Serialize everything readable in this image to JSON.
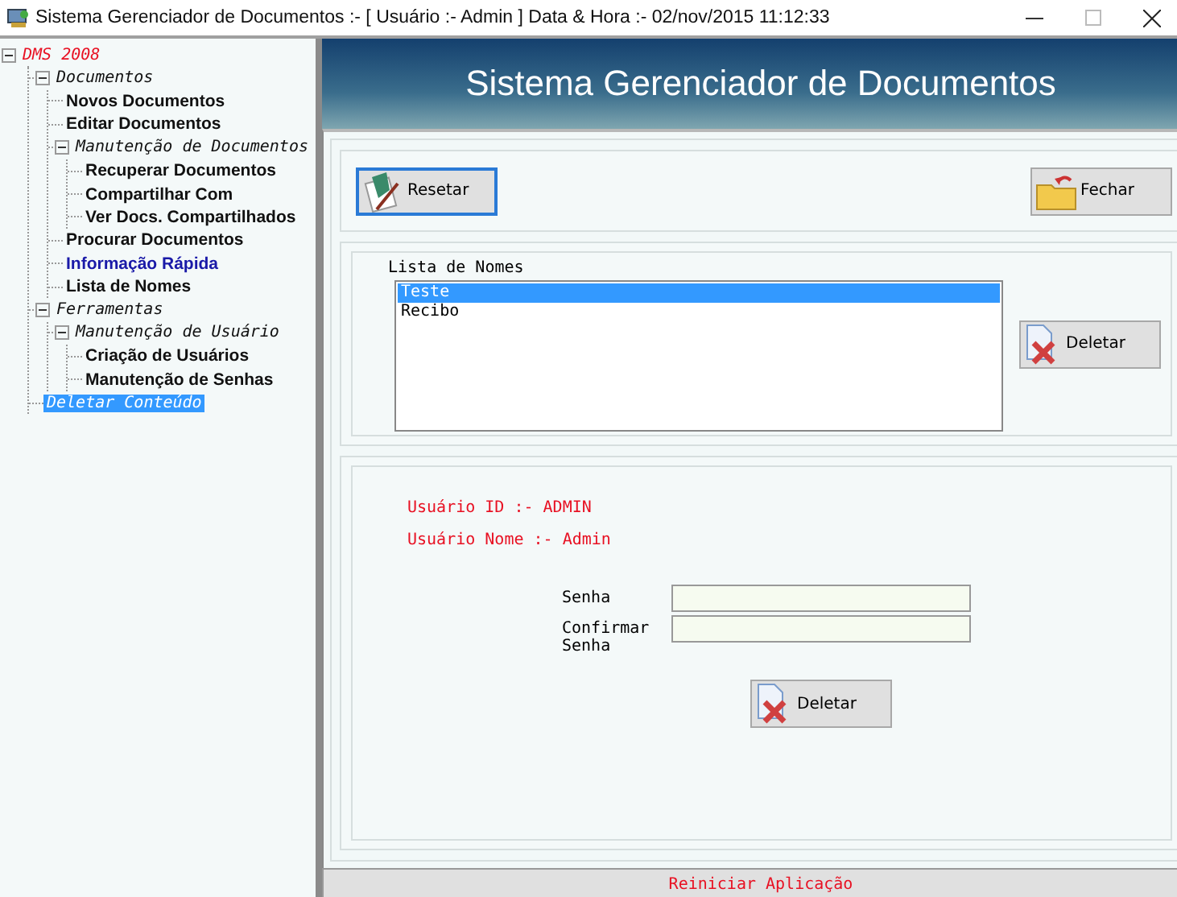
{
  "window": {
    "title": "Sistema Gerenciador de Documentos :- [ Usuário :- Admin ]  Data & Hora :- 02/nov/2015 11:12:33"
  },
  "tree": [
    {
      "label": "DMS 2008",
      "kind": "root",
      "expanded": true,
      "selected": false,
      "hover": false,
      "children": [
        {
          "label": "Documentos",
          "kind": "group",
          "expanded": true,
          "selected": false,
          "hover": false,
          "children": [
            {
              "label": "Novos Documentos",
              "kind": "leaf",
              "selected": false,
              "hover": false
            },
            {
              "label": "Editar Documentos",
              "kind": "leaf",
              "selected": false,
              "hover": false
            },
            {
              "label": "Manutenção de Documentos",
              "kind": "group",
              "expanded": true,
              "selected": false,
              "hover": false,
              "children": [
                {
                  "label": "Recuperar Documentos",
                  "kind": "leaf",
                  "selected": false,
                  "hover": false
                },
                {
                  "label": "Compartilhar Com",
                  "kind": "leaf",
                  "selected": false,
                  "hover": false
                },
                {
                  "label": "Ver Docs. Compartilhados",
                  "kind": "leaf",
                  "selected": false,
                  "hover": false
                }
              ]
            },
            {
              "label": "Procurar Documentos",
              "kind": "leaf",
              "selected": false,
              "hover": false
            },
            {
              "label": "Informação Rápida",
              "kind": "leaf",
              "selected": false,
              "hover": true
            },
            {
              "label": "Lista de Nomes",
              "kind": "leaf",
              "selected": false,
              "hover": false
            }
          ]
        },
        {
          "label": "Ferramentas",
          "kind": "group",
          "expanded": true,
          "selected": false,
          "hover": false,
          "children": [
            {
              "label": "Manutenção de Usuário",
              "kind": "group",
              "expanded": true,
              "selected": false,
              "hover": false,
              "children": [
                {
                  "label": "Criação de Usuários",
                  "kind": "leaf",
                  "selected": false,
                  "hover": false
                },
                {
                  "label": "Manutenção de Senhas",
                  "kind": "leaf",
                  "selected": false,
                  "hover": false
                }
              ]
            }
          ]
        },
        {
          "label": "Deletar Conteúdo",
          "kind": "group",
          "selected": true,
          "hover": false
        }
      ]
    }
  ],
  "header": {
    "title": "Sistema Gerenciador de Documentos"
  },
  "toolbar": {
    "reset_button": "Resetar",
    "close_button": "Fechar"
  },
  "names": {
    "label": "Lista de Nomes",
    "items": [
      {
        "text": "Teste",
        "selected": true
      },
      {
        "text": "Recibo",
        "selected": false
      }
    ],
    "delete_button": "Deletar"
  },
  "user": {
    "id_line": "Usuário ID :- ADMIN",
    "name_line": "Usuário Nome :- Admin",
    "password_label": "Senha",
    "confirm_label": "Confirmar Senha",
    "delete_button": "Deletar"
  },
  "status_bar": {
    "restart": "Reiniciar Aplicação"
  }
}
